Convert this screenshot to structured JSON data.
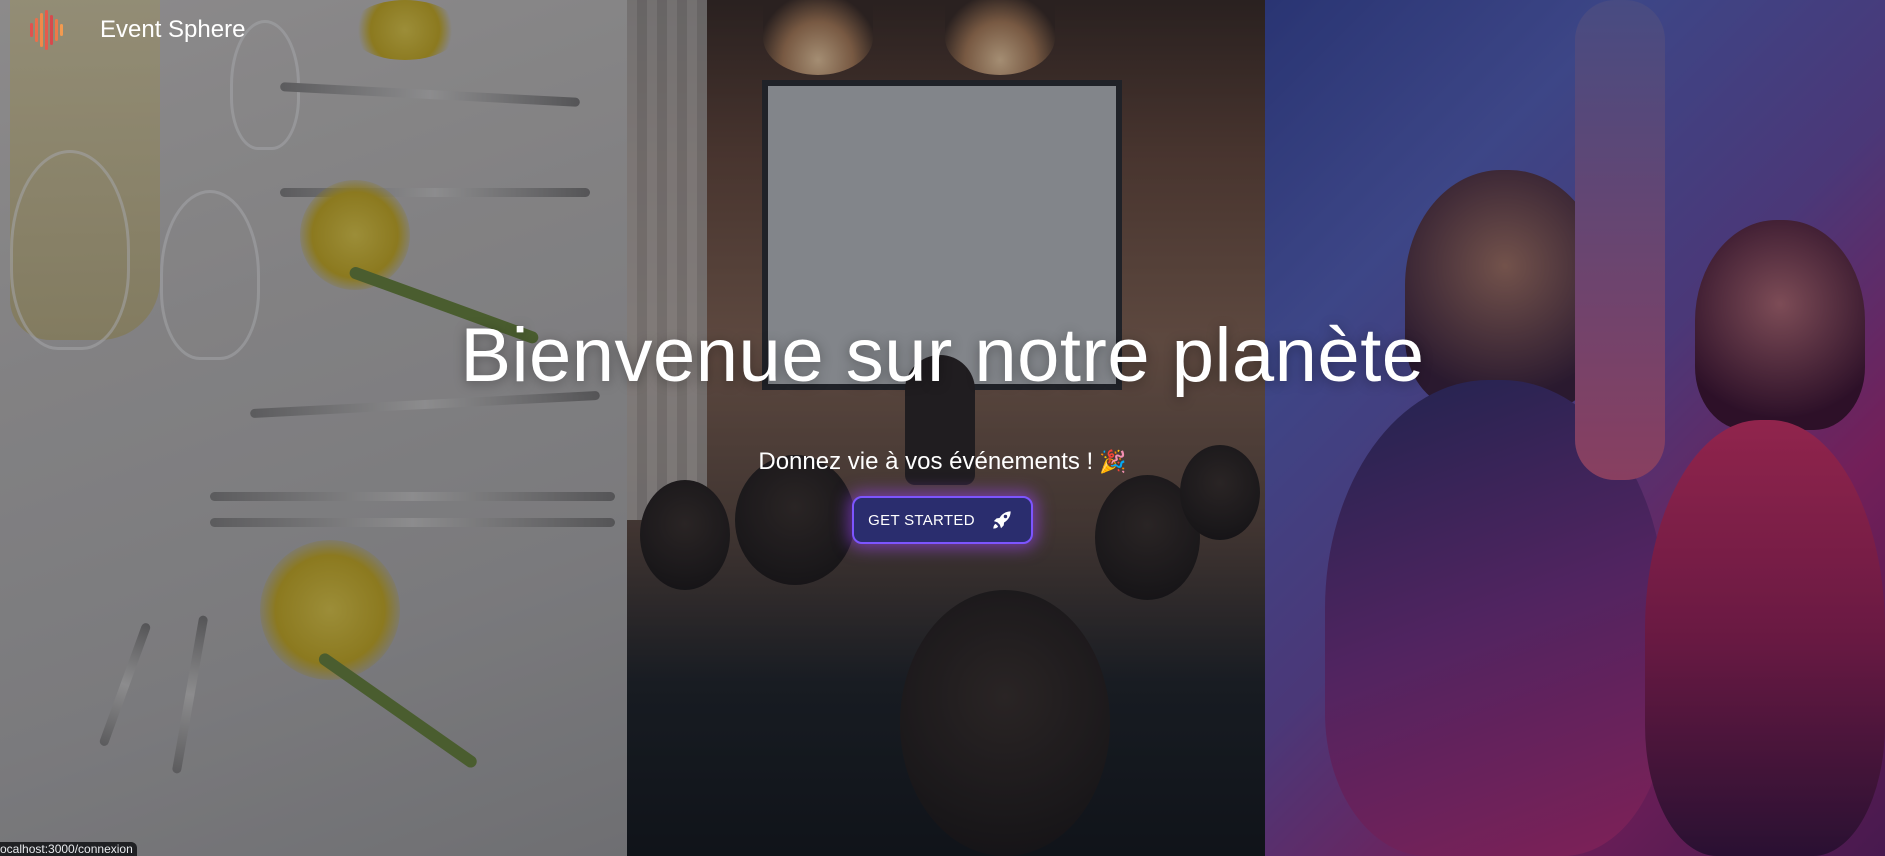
{
  "app": {
    "brand": "Event Sphere",
    "logo_icon": "sound-wave-icon",
    "logo_colors": [
      "#e0524f",
      "#ec6e4a",
      "#f0894a",
      "#e55a4c",
      "#d74a4d",
      "#ee7a48",
      "#f29a50"
    ]
  },
  "hero": {
    "title": "Bienvenue sur notre planète",
    "subtitle": "Donnez vie à vos événements !",
    "subtitle_emoji": "🎉",
    "cta_label": "GET STARTED",
    "cta_icon": "rocket-icon",
    "cta_colors": {
      "background": "#2a2d6e",
      "border": "#7d55ff",
      "glow": "#a046ff"
    },
    "images": [
      "dining-table-photo",
      "conference-photo",
      "party-photo"
    ]
  },
  "status_bar": {
    "url": "ocalhost:3000/connexion"
  }
}
